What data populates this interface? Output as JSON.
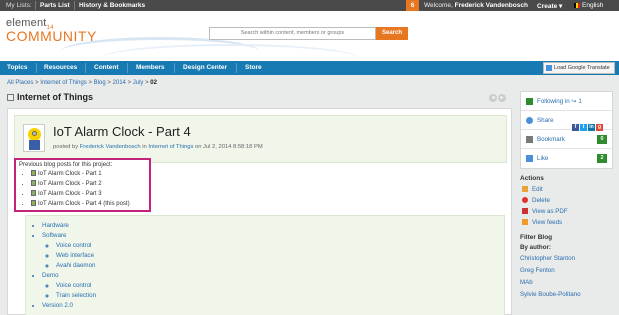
{
  "topbar": {
    "my_lists": "My Lists:",
    "parts_list": "Parts List",
    "history": "History & Bookmarks",
    "notifications": "6",
    "welcome": "Welcome,",
    "user": "Frederick Vandenbosch",
    "create": "Create ▾",
    "language": "English"
  },
  "header": {
    "logo_top": "element",
    "logo_sub": "14",
    "logo_bottom": "COMMUNITY",
    "search_placeholder": "Search within content, members or groups",
    "search_button": "Search"
  },
  "nav": {
    "items": [
      "Topics",
      "Resources",
      "Content",
      "Members",
      "Design Center",
      "Store"
    ],
    "translate": "Load Google Translate"
  },
  "breadcrumb": {
    "items": [
      "All Places",
      "Internet of Things",
      "Blog",
      "2014",
      "July"
    ],
    "current": "02",
    "sep": ">"
  },
  "page_title": "Internet of Things",
  "arrows": {
    "prev": "◂",
    "next": "▸"
  },
  "post": {
    "title": "IoT Alarm Clock - Part 4",
    "meta_posted": "posted by",
    "author": "Frederick Vandenbosch",
    "meta_in": "in",
    "place": "Internet of Things",
    "meta_date": "on Jul 2, 2014 8:58:18 PM"
  },
  "previous": {
    "label": "Previous blog posts for this project:",
    "items": [
      "IoT Alarm Clock - Part 1",
      "IoT Alarm Clock - Part 2",
      "IoT Alarm Clock - Part 3",
      "IoT Alarm Clock - Part 4 (this post)"
    ]
  },
  "toc": {
    "hardware": "Hardware",
    "software": "Software",
    "software_items": [
      "Voice control",
      "Web interface",
      "Avahi daemon"
    ],
    "demo": "Demo",
    "demo_items": [
      "Voice control",
      "Train selection"
    ],
    "version": "Version 2.0"
  },
  "sidebar": {
    "following_label": "Following in",
    "following_count": "1",
    "share": "Share",
    "bookmark": "Bookmark",
    "bookmark_count": "0",
    "like": "Like",
    "like_count": "2",
    "actions_title": "Actions",
    "actions": [
      "Edit",
      "Delete",
      "View as PDF",
      "View feeds"
    ],
    "filter_title": "Filter Blog",
    "by_author": "By author:",
    "authors": [
      "Christopher Stanton",
      "Greg Fenton",
      "MAb",
      "Sylvie Boube-Politano"
    ]
  },
  "colors": {
    "accent_orange": "#e87722",
    "nav_blue": "#177ab3",
    "highlight_magenta": "#c4237b",
    "count_green": "#2e8b2e"
  }
}
